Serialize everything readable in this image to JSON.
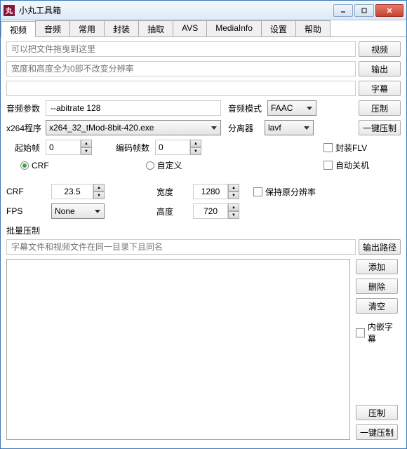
{
  "window": {
    "title": "小丸工具箱"
  },
  "tabs": [
    "视频",
    "音频",
    "常用",
    "封装",
    "抽取",
    "AVS",
    "MediaInfo",
    "设置",
    "帮助"
  ],
  "buttons": {
    "video": "视频",
    "output": "输出",
    "subtitle": "字幕",
    "compress": "压制",
    "onekey": "一键压制",
    "outpath": "输出路径",
    "add": "添加",
    "delete": "删除",
    "clear": "清空",
    "compress2": "压制",
    "onekey2": "一键压制"
  },
  "placeholders": {
    "drag": "可以把文件拖曳到这里",
    "wh": "宽度和高度全为0即不改变分辨率",
    "batch": "字幕文件和视频文件在同一目录下且同名"
  },
  "labels": {
    "audioParams": "音频参数",
    "x264prog": "x264程序",
    "startFrame": "起始帧",
    "encFrames": "编码帧数",
    "audioMode": "音频模式",
    "demuxer": "分离器",
    "wrapFlv": "封装FLV",
    "autoShut": "自动关机",
    "crf": "CRF",
    "custom": "自定义",
    "crfLabel": "CRF",
    "fps": "FPS",
    "width": "宽度",
    "height": "高度",
    "keepRes": "保持原分辨率",
    "batch": "批量压制",
    "embedSub": "内嵌字幕"
  },
  "values": {
    "audioParams": "--abitrate 128",
    "x264prog": "x264_32_tMod-8bit-420.exe",
    "startFrame": "0",
    "encFrames": "0",
    "audioMode": "FAAC",
    "demuxer": "lavf",
    "crf": "23.5",
    "fps": "None",
    "width": "1280",
    "height": "720"
  }
}
